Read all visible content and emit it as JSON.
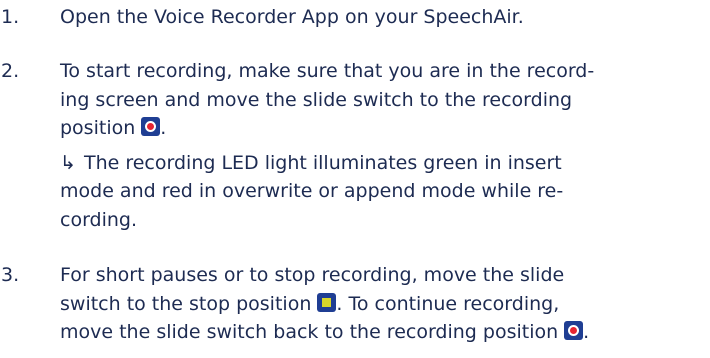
{
  "steps": [
    {
      "number": "1.",
      "lines": [
        "Open the Voice Recorder App on your SpeechAir."
      ]
    },
    {
      "number": "2.",
      "lines": [
        "To start recording, make sure that you are in the record-",
        "ing screen and move the slide switch to the recording",
        "position"
      ],
      "line3_suffix": ".",
      "result_arrow": "↳",
      "result_lines": [
        "The recording LED light illuminates green in insert",
        "mode and red in overwrite or append mode while re-",
        "cording."
      ]
    },
    {
      "number": "3.",
      "line1": "For short pauses or to stop recording, move the slide",
      "line2_before": "switch to the stop position",
      "line2_after": ". To continue recording,",
      "line3_before": "move the slide switch back to the recording position",
      "line3_after": "."
    }
  ],
  "icons": {
    "record": "record-position-icon",
    "stop": "stop-position-icon"
  },
  "colors": {
    "text": "#1d2b52",
    "icon_background": "#1f3e93",
    "record_dot": "#e62532",
    "stop_square": "#d8d62a"
  }
}
